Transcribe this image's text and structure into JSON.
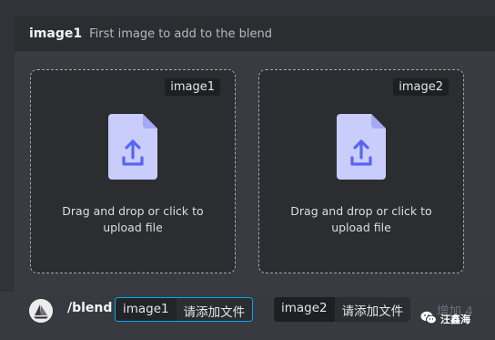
{
  "header": {
    "title": "image1",
    "description": "First image to add to the blend"
  },
  "dropzones": [
    {
      "tag": "image1",
      "text": "Drag and drop or click to upload file"
    },
    {
      "tag": "image2",
      "text": "Drag and drop or click to upload file"
    }
  ],
  "command": {
    "name": "/blend",
    "options": [
      {
        "name": "image1",
        "value": "请添加文件"
      },
      {
        "name": "image2",
        "value": "请添加文件"
      }
    ],
    "more": "增加 4"
  },
  "watermark": {
    "text": "汪鑫海",
    "icon": "wechat-icon"
  },
  "colors": {
    "accent": "#00a8fc",
    "file_icon": "#c9cdfb",
    "file_arrow": "#5865f2"
  }
}
